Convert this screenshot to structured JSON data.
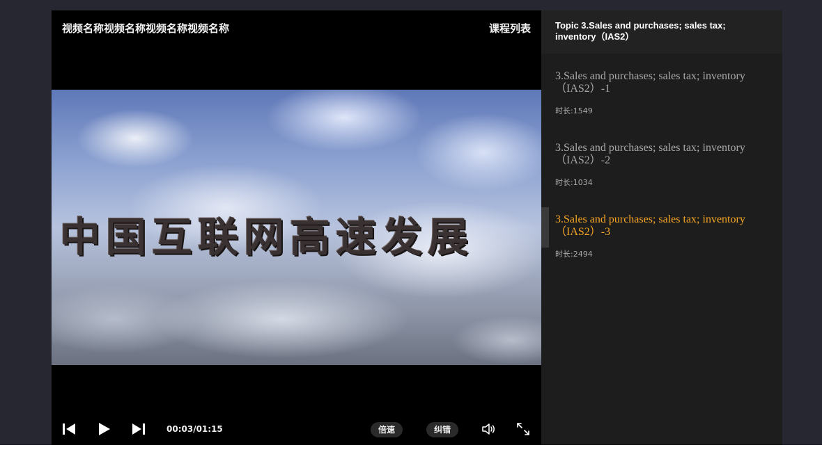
{
  "player": {
    "title": "视频名称视频名称视频名称视频名称",
    "course_list_label": "课程列表",
    "overlay_text": "中国互联网高速发展",
    "time_display": "00:03/01:15",
    "speed_label": "倍速",
    "report_error_label": "纠错",
    "icons": {
      "previous": "skip-previous-icon",
      "play": "play-icon",
      "next": "skip-next-icon",
      "volume": "volume-icon",
      "fullscreen": "fullscreen-icon"
    }
  },
  "sidebar": {
    "header_title": "Topic 3.Sales and purchases; sales tax; inventory（IAS2）",
    "lessons": [
      {
        "title": "3.Sales and purchases; sales tax; inventory（IAS2）-1",
        "duration": "时长:1549",
        "active": false
      },
      {
        "title": "3.Sales and purchases; sales tax; inventory（IAS2）-2",
        "duration": "时长:1034",
        "active": false
      },
      {
        "title": "3.Sales and purchases; sales tax; inventory（IAS2）-3",
        "duration": "时长:2494",
        "active": true
      }
    ]
  },
  "colors": {
    "page_background": "#272731",
    "player_background": "#000000",
    "sidebar_background": "#1d1d1d",
    "active_lesson": "#f5a623",
    "inactive_lesson": "#a9a9a9"
  }
}
